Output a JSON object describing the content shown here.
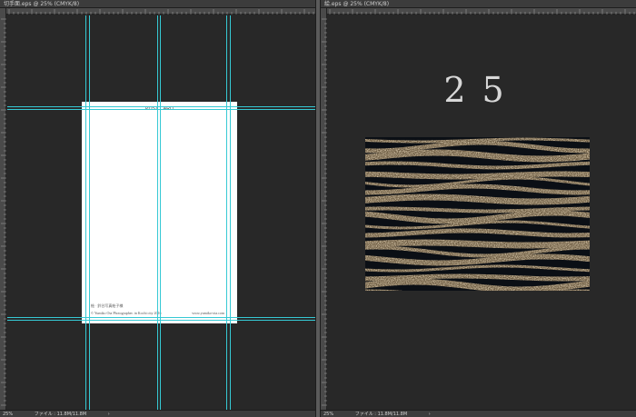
{
  "left_doc": {
    "tab_title": "切手面.eps @ 25% (CMYK/8)",
    "status": {
      "zoom": "25%",
      "file_info": "ファイル : 11.8M/11.8M",
      "arrow": "›"
    },
    "postcard": {
      "title": "POST CARD",
      "credit_line1": "絵 · 鈴谷写真絵子様",
      "credit_line2": "© Yumiko Ota Photographer. in Kochi city 2016",
      "url": "www.yumiko-ota.com"
    }
  },
  "right_doc": {
    "tab_title": "絵.eps @ 25% (CMYK/8)",
    "status": {
      "zoom": "25%",
      "file_info": "ファイル : 11.8M/11.8M",
      "arrow": "›"
    },
    "big_number": "25"
  },
  "colors": {
    "guide": "#36c9d4",
    "canvas": "#282828",
    "chrome": "#3c3c3c",
    "ruler": "#4a4a4a"
  }
}
